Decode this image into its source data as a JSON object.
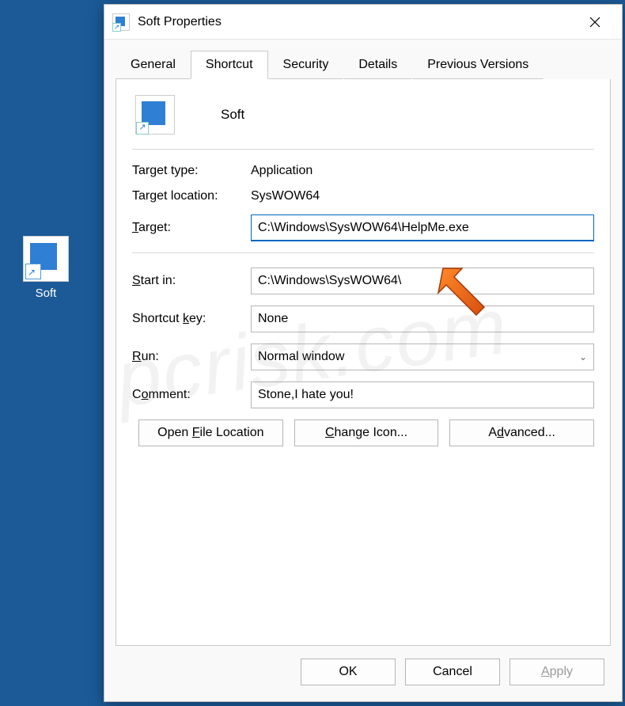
{
  "desktop": {
    "icon_label": "Soft"
  },
  "dialog": {
    "title": "Soft Properties",
    "tabs": [
      "General",
      "Shortcut",
      "Security",
      "Details",
      "Previous Versions"
    ],
    "active_tab": "Shortcut",
    "header_name": "Soft",
    "fields": {
      "target_type_label": "Target type:",
      "target_type_value": "Application",
      "target_location_label": "Target location:",
      "target_location_value": "SysWOW64",
      "target_label": "Target:",
      "target_value": "C:\\Windows\\SysWOW64\\HelpMe.exe",
      "start_in_label": "Start in:",
      "start_in_value": "C:\\Windows\\SysWOW64\\",
      "shortcut_key_label": "Shortcut key:",
      "shortcut_key_value": "None",
      "run_label": "Run:",
      "run_value": "Normal window",
      "comment_label": "Comment:",
      "comment_value": "Stone,I hate you!"
    },
    "buttons": {
      "open_file_location": "Open File Location",
      "change_icon": "Change Icon...",
      "advanced": "Advanced...",
      "ok": "OK",
      "cancel": "Cancel",
      "apply": "Apply"
    }
  },
  "watermark": "pcrisk.com"
}
